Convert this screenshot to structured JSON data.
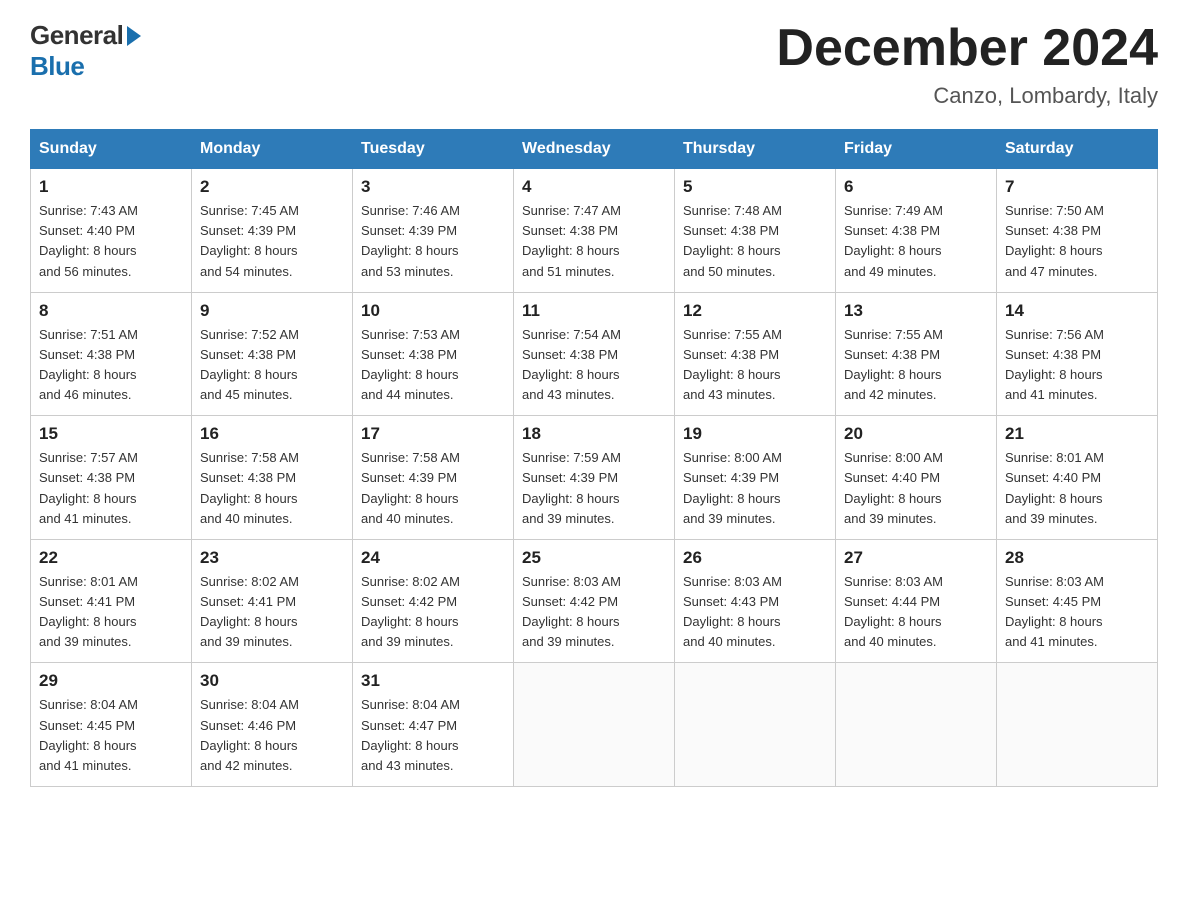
{
  "logo": {
    "general": "General",
    "blue": "Blue"
  },
  "header": {
    "month": "December 2024",
    "location": "Canzo, Lombardy, Italy"
  },
  "days_of_week": [
    "Sunday",
    "Monday",
    "Tuesday",
    "Wednesday",
    "Thursday",
    "Friday",
    "Saturday"
  ],
  "weeks": [
    [
      {
        "day": "1",
        "sunrise": "7:43 AM",
        "sunset": "4:40 PM",
        "daylight": "8 hours and 56 minutes."
      },
      {
        "day": "2",
        "sunrise": "7:45 AM",
        "sunset": "4:39 PM",
        "daylight": "8 hours and 54 minutes."
      },
      {
        "day": "3",
        "sunrise": "7:46 AM",
        "sunset": "4:39 PM",
        "daylight": "8 hours and 53 minutes."
      },
      {
        "day": "4",
        "sunrise": "7:47 AM",
        "sunset": "4:38 PM",
        "daylight": "8 hours and 51 minutes."
      },
      {
        "day": "5",
        "sunrise": "7:48 AM",
        "sunset": "4:38 PM",
        "daylight": "8 hours and 50 minutes."
      },
      {
        "day": "6",
        "sunrise": "7:49 AM",
        "sunset": "4:38 PM",
        "daylight": "8 hours and 49 minutes."
      },
      {
        "day": "7",
        "sunrise": "7:50 AM",
        "sunset": "4:38 PM",
        "daylight": "8 hours and 47 minutes."
      }
    ],
    [
      {
        "day": "8",
        "sunrise": "7:51 AM",
        "sunset": "4:38 PM",
        "daylight": "8 hours and 46 minutes."
      },
      {
        "day": "9",
        "sunrise": "7:52 AM",
        "sunset": "4:38 PM",
        "daylight": "8 hours and 45 minutes."
      },
      {
        "day": "10",
        "sunrise": "7:53 AM",
        "sunset": "4:38 PM",
        "daylight": "8 hours and 44 minutes."
      },
      {
        "day": "11",
        "sunrise": "7:54 AM",
        "sunset": "4:38 PM",
        "daylight": "8 hours and 43 minutes."
      },
      {
        "day": "12",
        "sunrise": "7:55 AM",
        "sunset": "4:38 PM",
        "daylight": "8 hours and 43 minutes."
      },
      {
        "day": "13",
        "sunrise": "7:55 AM",
        "sunset": "4:38 PM",
        "daylight": "8 hours and 42 minutes."
      },
      {
        "day": "14",
        "sunrise": "7:56 AM",
        "sunset": "4:38 PM",
        "daylight": "8 hours and 41 minutes."
      }
    ],
    [
      {
        "day": "15",
        "sunrise": "7:57 AM",
        "sunset": "4:38 PM",
        "daylight": "8 hours and 41 minutes."
      },
      {
        "day": "16",
        "sunrise": "7:58 AM",
        "sunset": "4:38 PM",
        "daylight": "8 hours and 40 minutes."
      },
      {
        "day": "17",
        "sunrise": "7:58 AM",
        "sunset": "4:39 PM",
        "daylight": "8 hours and 40 minutes."
      },
      {
        "day": "18",
        "sunrise": "7:59 AM",
        "sunset": "4:39 PM",
        "daylight": "8 hours and 39 minutes."
      },
      {
        "day": "19",
        "sunrise": "8:00 AM",
        "sunset": "4:39 PM",
        "daylight": "8 hours and 39 minutes."
      },
      {
        "day": "20",
        "sunrise": "8:00 AM",
        "sunset": "4:40 PM",
        "daylight": "8 hours and 39 minutes."
      },
      {
        "day": "21",
        "sunrise": "8:01 AM",
        "sunset": "4:40 PM",
        "daylight": "8 hours and 39 minutes."
      }
    ],
    [
      {
        "day": "22",
        "sunrise": "8:01 AM",
        "sunset": "4:41 PM",
        "daylight": "8 hours and 39 minutes."
      },
      {
        "day": "23",
        "sunrise": "8:02 AM",
        "sunset": "4:41 PM",
        "daylight": "8 hours and 39 minutes."
      },
      {
        "day": "24",
        "sunrise": "8:02 AM",
        "sunset": "4:42 PM",
        "daylight": "8 hours and 39 minutes."
      },
      {
        "day": "25",
        "sunrise": "8:03 AM",
        "sunset": "4:42 PM",
        "daylight": "8 hours and 39 minutes."
      },
      {
        "day": "26",
        "sunrise": "8:03 AM",
        "sunset": "4:43 PM",
        "daylight": "8 hours and 40 minutes."
      },
      {
        "day": "27",
        "sunrise": "8:03 AM",
        "sunset": "4:44 PM",
        "daylight": "8 hours and 40 minutes."
      },
      {
        "day": "28",
        "sunrise": "8:03 AM",
        "sunset": "4:45 PM",
        "daylight": "8 hours and 41 minutes."
      }
    ],
    [
      {
        "day": "29",
        "sunrise": "8:04 AM",
        "sunset": "4:45 PM",
        "daylight": "8 hours and 41 minutes."
      },
      {
        "day": "30",
        "sunrise": "8:04 AM",
        "sunset": "4:46 PM",
        "daylight": "8 hours and 42 minutes."
      },
      {
        "day": "31",
        "sunrise": "8:04 AM",
        "sunset": "4:47 PM",
        "daylight": "8 hours and 43 minutes."
      },
      null,
      null,
      null,
      null
    ]
  ],
  "labels": {
    "sunrise": "Sunrise:",
    "sunset": "Sunset:",
    "daylight": "Daylight:"
  }
}
